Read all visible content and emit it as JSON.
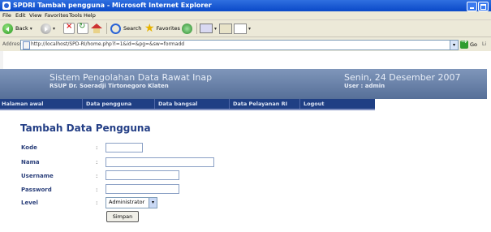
{
  "window": {
    "title": "SPDRI   Tambah pengguna - Microsoft Internet Explorer"
  },
  "menu": [
    "File",
    "Edit",
    "View",
    "Favorites",
    "Tools",
    "Help"
  ],
  "toolbar": {
    "back_label": "Back",
    "search_label": "Search",
    "favorites_label": "Favorites"
  },
  "address": {
    "label": "Address",
    "url": "http://localhost/SPD-RI/home.php?l=1&id=&pg=&sw=formadd",
    "go_label": "Go",
    "links_label": "Li"
  },
  "banner": {
    "app_title": "Sistem Pengolahan Data Rawat Inap",
    "hospital": "RSUP Dr. Soeradji Tirtonegoro Klaten",
    "date": "Senin, 24 Desember 2007",
    "user": "User : admin"
  },
  "nav": [
    "Halaman awal",
    "Data pengguna",
    "Data bangsal",
    "Data Pelayanan RI",
    "Logout"
  ],
  "form": {
    "title": "Tambah Data Pengguna",
    "colon": ":",
    "fields": [
      {
        "label": "Kode",
        "value": ""
      },
      {
        "label": "Nama",
        "value": ""
      },
      {
        "label": "Username",
        "value": ""
      },
      {
        "label": "Password",
        "value": ""
      }
    ],
    "level_label": "Level",
    "level_value": "Administrator",
    "submit_label": "Simpan"
  }
}
